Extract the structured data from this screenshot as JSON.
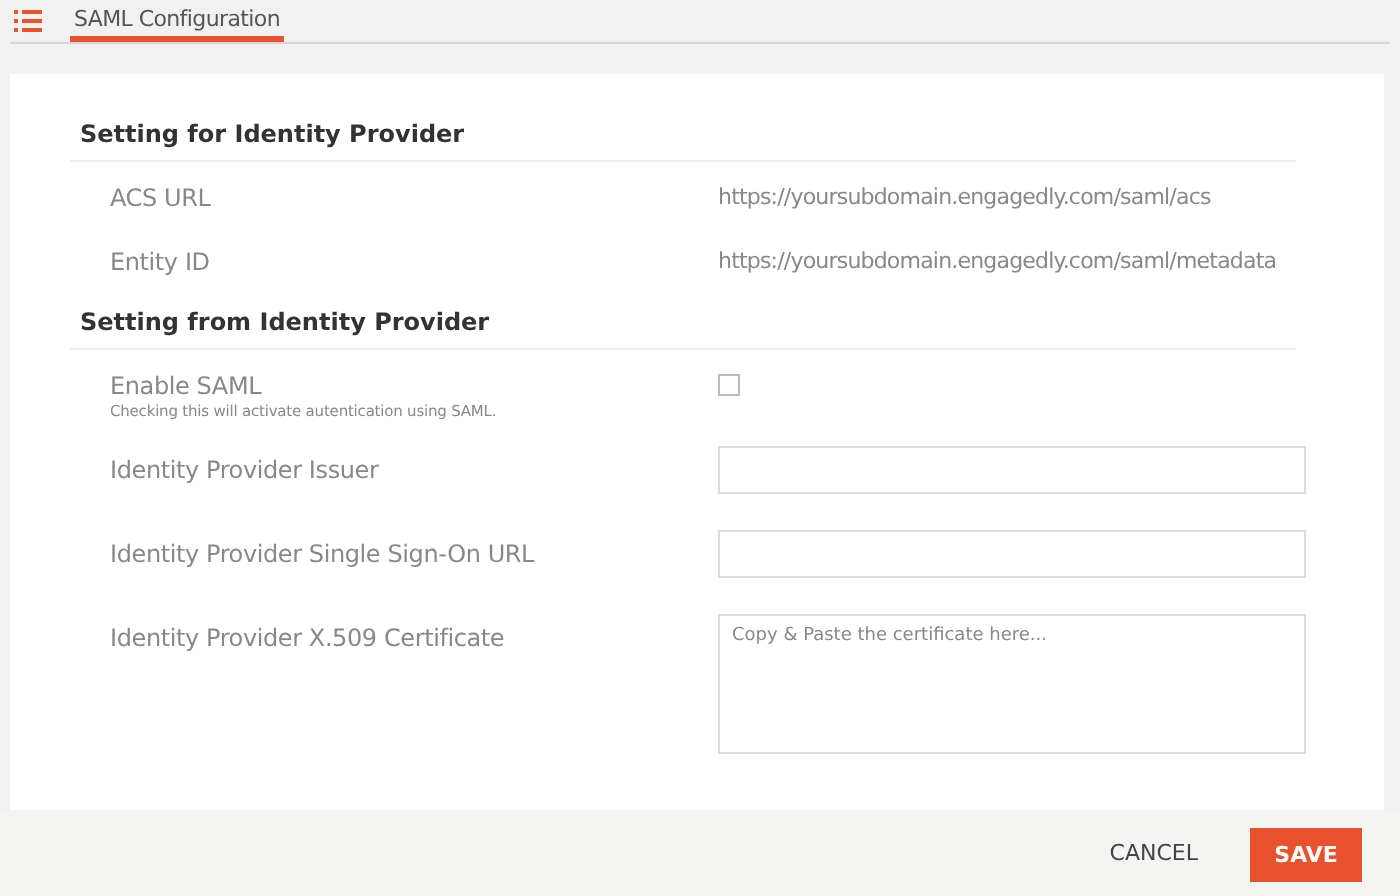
{
  "tabs": [
    {
      "label": "SAML Configuration",
      "selected": true
    }
  ],
  "sections": [
    {
      "title": "Setting for Identity Provider",
      "rows": [
        {
          "kind": "info",
          "label": "ACS URL",
          "value": "https://yoursubdomain.engagedly.com/saml/acs"
        },
        {
          "kind": "info",
          "label": "Entity ID",
          "value": "https://yoursubdomain.engagedly.com/saml/metadata"
        }
      ]
    },
    {
      "title": "Setting from Identity Provider",
      "rows": [
        {
          "kind": "checkbox",
          "label": "Enable SAML",
          "hint": "Checking this will activate autentication using SAML.",
          "checked": false
        },
        {
          "kind": "text",
          "label": "Identity Provider Issuer"
        },
        {
          "kind": "text",
          "label": "Identity Provider Single Sign-On URL"
        },
        {
          "kind": "textarea",
          "label": "Identity Provider X.509 Certificate",
          "placeholder": "Copy & Paste the certificate here..."
        }
      ]
    }
  ],
  "buttons": [
    {
      "label": "CANCEL",
      "kind": "secondary"
    },
    {
      "label": "SAVE",
      "kind": "primary"
    }
  ]
}
